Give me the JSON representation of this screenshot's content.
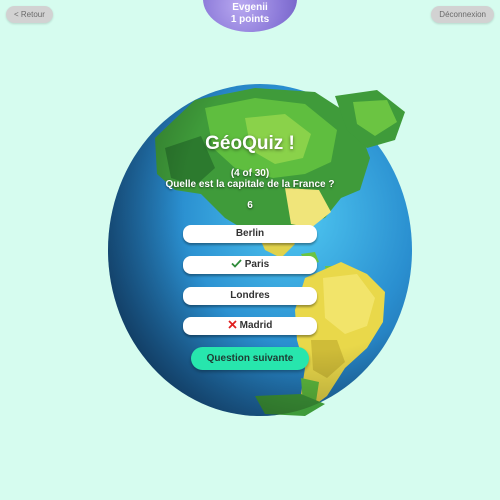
{
  "nav": {
    "back_label": "< Retour",
    "logout_label": "Déconnexion"
  },
  "user": {
    "name": "Evgenii",
    "points": "1 points"
  },
  "quiz": {
    "title": "GéoQuiz !",
    "progress": "(4 of 30)",
    "question": "Quelle est la capitale de la France ?",
    "timer": "6",
    "answers": [
      {
        "label": "Berlin",
        "state": "neutral"
      },
      {
        "label": "Paris",
        "state": "correct",
        "icon": "check-icon"
      },
      {
        "label": "Londres",
        "state": "neutral"
      },
      {
        "label": "Madrid",
        "state": "wrong",
        "icon": "cross-icon"
      }
    ],
    "next_label": "Question suivante"
  },
  "colors": {
    "background": "#d6fcef",
    "accent": "#27e6ad",
    "correct": "#2e8b3a",
    "wrong": "#e02020"
  }
}
